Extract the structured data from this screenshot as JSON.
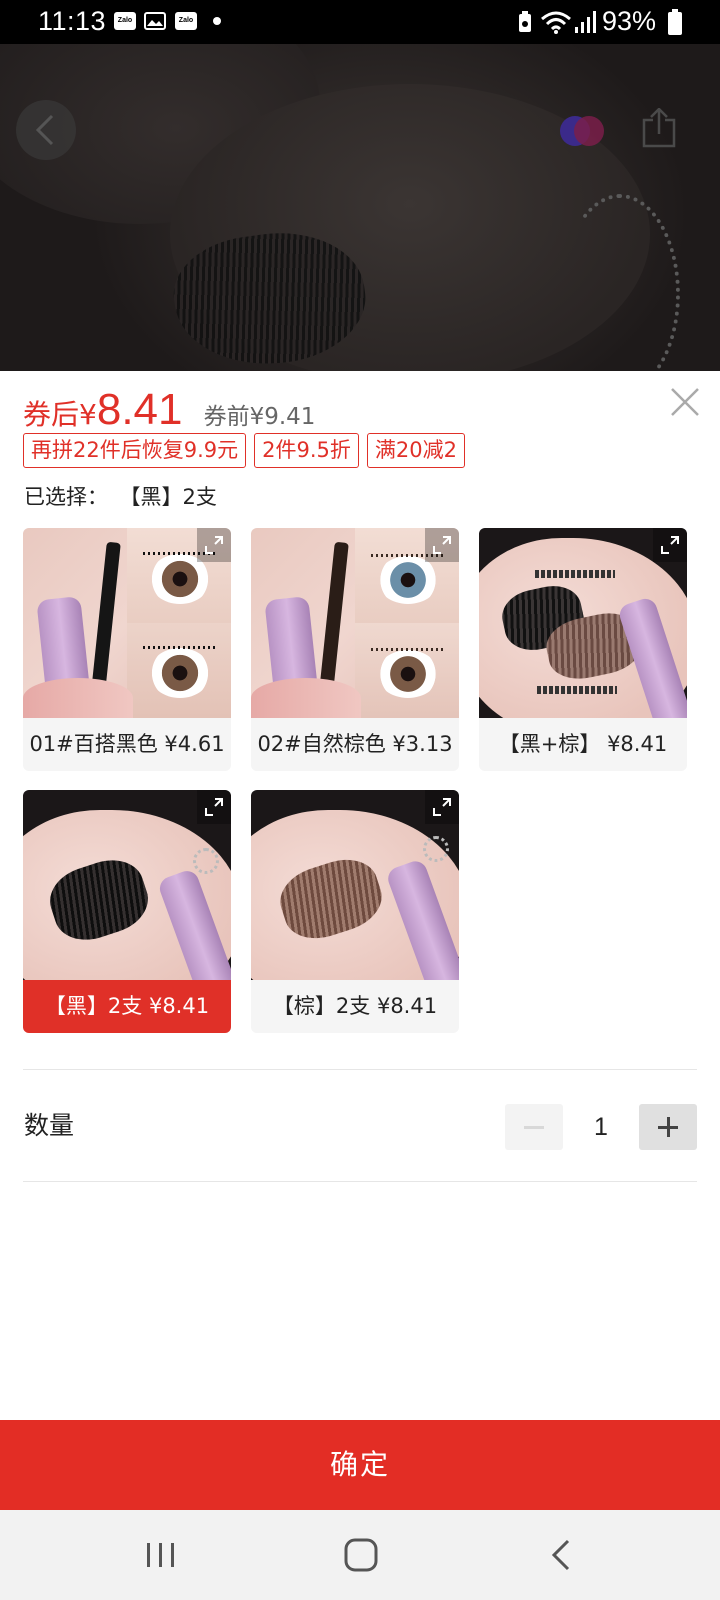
{
  "status_bar": {
    "time": "11:13",
    "app_icons": [
      "Zalo",
      "gallery-icon",
      "Zalo"
    ],
    "battery": "93%"
  },
  "pricing": {
    "after_coupon_prefix": "券后",
    "currency": "¥",
    "after_coupon_value": "8.41",
    "before_coupon_label": "券前¥9.41"
  },
  "promo_tags": [
    "再拼22件后恢复9.9元",
    "2件9.5折",
    "满20减2"
  ],
  "selection": {
    "label": "已选择：",
    "value": "【黑】2支"
  },
  "variants": [
    {
      "label": "01#百搭黑色 ¥4.61",
      "selected": false
    },
    {
      "label": "02#自然棕色 ¥3.13",
      "selected": false
    },
    {
      "label": "【黑+棕】 ¥8.41",
      "selected": false
    },
    {
      "label": "【黑】2支 ¥8.41",
      "selected": true
    },
    {
      "label": "【棕】2支 ¥8.41",
      "selected": false
    }
  ],
  "quantity": {
    "label": "数量",
    "value": "1"
  },
  "confirm_label": "确定",
  "colors": {
    "accent": "#e03028",
    "confirm": "#e32d25",
    "tag_border": "#e03028"
  }
}
